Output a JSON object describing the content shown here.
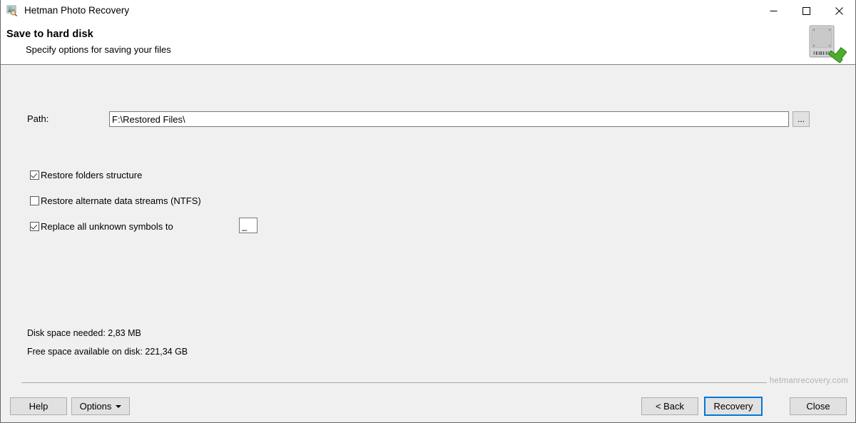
{
  "window": {
    "title": "Hetman Photo Recovery",
    "app_icon": "photo-recovery-icon",
    "controls": {
      "minimize": "minimize-icon",
      "maximize": "maximize-icon",
      "close": "close-icon"
    }
  },
  "header": {
    "title": "Save to hard disk",
    "subtitle": "Specify options for saving your files",
    "art_icon": "hard-disk-save-icon"
  },
  "form": {
    "path_label": "Path:",
    "path_value": "F:\\Restored Files\\",
    "path_placeholder": "",
    "browse_label": "...",
    "checkboxes": [
      {
        "label": "Restore folders structure",
        "checked": true
      },
      {
        "label": "Restore alternate data streams (NTFS)",
        "checked": false
      },
      {
        "label": "Replace all unknown symbols to",
        "checked": true
      }
    ],
    "replace_symbol_value": "_"
  },
  "status": {
    "space_needed": "Disk space needed: 2,83 MB",
    "space_free": "Free space available on disk: 221,34 GB"
  },
  "footer": {
    "watermark": "hetmanrecovery.com",
    "help_label": "Help",
    "options_label": "Options",
    "back_label": "< Back",
    "recovery_label": "Recovery",
    "close_label": "Close"
  },
  "colors": {
    "accent": "#0078d7",
    "body_bg": "#f0f0f0",
    "header_bg": "#ffffff",
    "button_bg": "#e1e1e1",
    "watermark": "#b4b4b4"
  }
}
